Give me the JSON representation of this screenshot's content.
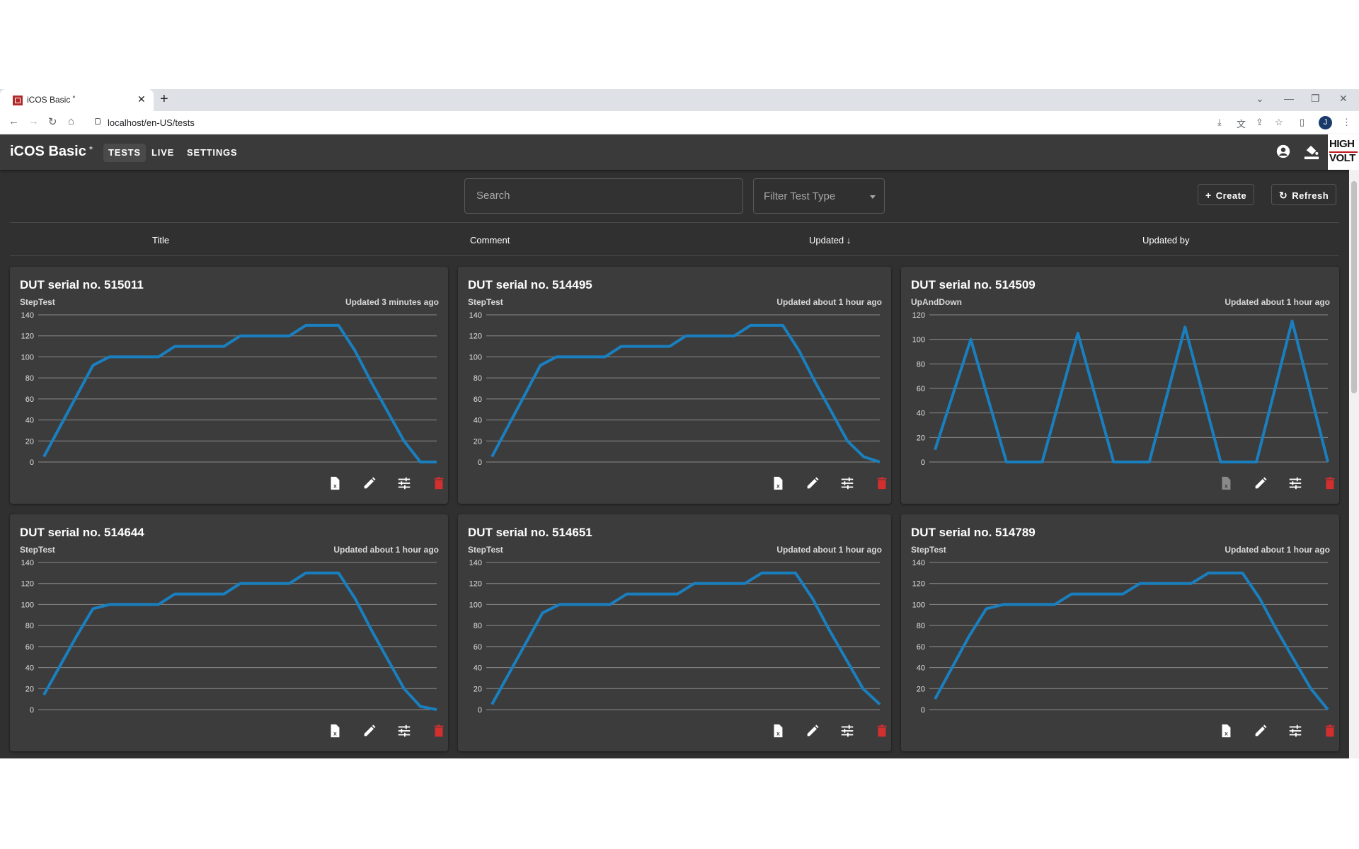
{
  "browser": {
    "tab_title": "iCOS Basic ˚",
    "url": "localhost/en-US/tests",
    "profile_initial": "J"
  },
  "app": {
    "name": "iCOS Basic",
    "name_sup": "+",
    "nav": [
      "TESTS",
      "LIVE",
      "SETTINGS"
    ],
    "active_nav": "TESTS",
    "logo_line1": "HIGH",
    "logo_line2": "VOLT",
    "accent_color": "#1a7fbf",
    "delete_color": "#d32f2f"
  },
  "filters": {
    "search_placeholder": "Search",
    "type_placeholder": "Filter Test Type",
    "create_label": "Create",
    "refresh_label": "Refresh"
  },
  "columns": {
    "title": "Title",
    "comment": "Comment",
    "updated": "Updated",
    "updated_by": "Updated by",
    "sort_indicator": "↓"
  },
  "cards": [
    {
      "title": "DUT serial no. 515011",
      "type": "StepTest",
      "updated": "Updated 3 minutes ago",
      "chart_data": {
        "type": "line",
        "ymin": 0,
        "ymax": 140,
        "ticks": [
          0,
          20,
          40,
          60,
          80,
          100,
          120,
          140
        ],
        "y": [
          5,
          34,
          63,
          92,
          100,
          100,
          100,
          100,
          110,
          110,
          110,
          110,
          120,
          120,
          120,
          120,
          130,
          130,
          130,
          106,
          76,
          48,
          20,
          0,
          0
        ]
      }
    },
    {
      "title": "DUT serial no. 514495",
      "type": "StepTest",
      "updated": "Updated about 1 hour ago",
      "chart_data": {
        "type": "line",
        "ymin": 0,
        "ymax": 140,
        "ticks": [
          0,
          20,
          40,
          60,
          80,
          100,
          120,
          140
        ],
        "y": [
          5,
          34,
          63,
          92,
          100,
          100,
          100,
          100,
          110,
          110,
          110,
          110,
          120,
          120,
          120,
          120,
          130,
          130,
          130,
          106,
          76,
          48,
          20,
          5,
          0
        ]
      }
    },
    {
      "title": "DUT serial no. 514509",
      "type": "UpAndDown",
      "updated": "Updated about 1 hour ago",
      "export_disabled": true,
      "chart_data": {
        "type": "line",
        "ymin": 0,
        "ymax": 120,
        "ticks": [
          0,
          20,
          40,
          60,
          80,
          100,
          120
        ],
        "y": [
          10,
          100,
          0,
          0,
          105,
          0,
          0,
          110,
          0,
          0,
          115,
          0
        ]
      }
    },
    {
      "title": "DUT serial no. 514644",
      "type": "StepTest",
      "updated": "Updated about 1 hour ago",
      "chart_data": {
        "type": "line",
        "ymin": 0,
        "ymax": 140,
        "ticks": [
          0,
          20,
          40,
          60,
          80,
          100,
          120,
          140
        ],
        "y": [
          14,
          42,
          70,
          96,
          100,
          100,
          100,
          100,
          110,
          110,
          110,
          110,
          120,
          120,
          120,
          120,
          130,
          130,
          130,
          106,
          76,
          48,
          20,
          3,
          0
        ]
      }
    },
    {
      "title": "DUT serial no. 514651",
      "type": "StepTest",
      "updated": "Updated about 1 hour ago",
      "chart_data": {
        "type": "line",
        "ymin": 0,
        "ymax": 140,
        "ticks": [
          0,
          20,
          40,
          60,
          80,
          100,
          120,
          140
        ],
        "y": [
          5,
          34,
          63,
          92,
          100,
          100,
          100,
          100,
          110,
          110,
          110,
          110,
          120,
          120,
          120,
          120,
          130,
          130,
          130,
          106,
          76,
          48,
          20,
          5
        ]
      }
    },
    {
      "title": "DUT serial no. 514789",
      "type": "StepTest",
      "updated": "Updated about 1 hour ago",
      "chart_data": {
        "type": "line",
        "ymin": 0,
        "ymax": 140,
        "ticks": [
          0,
          20,
          40,
          60,
          80,
          100,
          120,
          140
        ],
        "y": [
          10,
          40,
          70,
          96,
          100,
          100,
          100,
          100,
          110,
          110,
          110,
          110,
          120,
          120,
          120,
          120,
          130,
          130,
          130,
          106,
          76,
          48,
          20,
          0
        ]
      }
    }
  ]
}
